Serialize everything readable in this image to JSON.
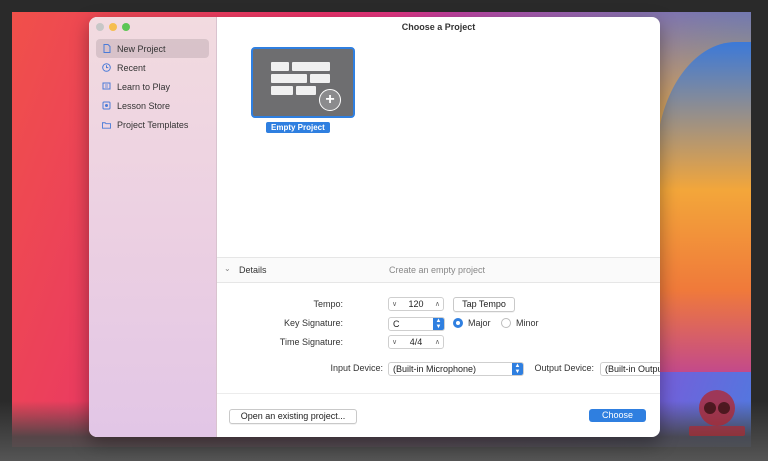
{
  "window": {
    "title": "Choose a Project"
  },
  "sidebar": {
    "items": [
      {
        "label": "New Project",
        "icon": "document-icon",
        "selected": true
      },
      {
        "label": "Recent",
        "icon": "clock-icon",
        "selected": false
      },
      {
        "label": "Learn to Play",
        "icon": "music-stand-icon",
        "selected": false
      },
      {
        "label": "Lesson Store",
        "icon": "store-icon",
        "selected": false
      },
      {
        "label": "Project Templates",
        "icon": "folder-icon",
        "selected": false
      }
    ]
  },
  "project": {
    "label": "Empty Project",
    "icon": "empty-project-grid-plus-icon"
  },
  "details": {
    "title": "Details",
    "description": "Create an empty project",
    "tempo_label": "Tempo:",
    "tempo_value": "120",
    "tap_tempo_label": "Tap Tempo",
    "key_label": "Key Signature:",
    "key_value": "C",
    "major_label": "Major",
    "minor_label": "Minor",
    "mode_selected": "Major",
    "time_label": "Time Signature:",
    "time_value": "4/4",
    "input_label": "Input Device:",
    "input_value": "(Built-in Microphone)",
    "output_label": "Output Device:",
    "output_value": "(Built-in Output)"
  },
  "footer": {
    "open_existing_label": "Open an existing project...",
    "choose_label": "Choose"
  },
  "colors": {
    "accent": "#2f7fe0",
    "sidebar_bg": "#efd6e1"
  }
}
